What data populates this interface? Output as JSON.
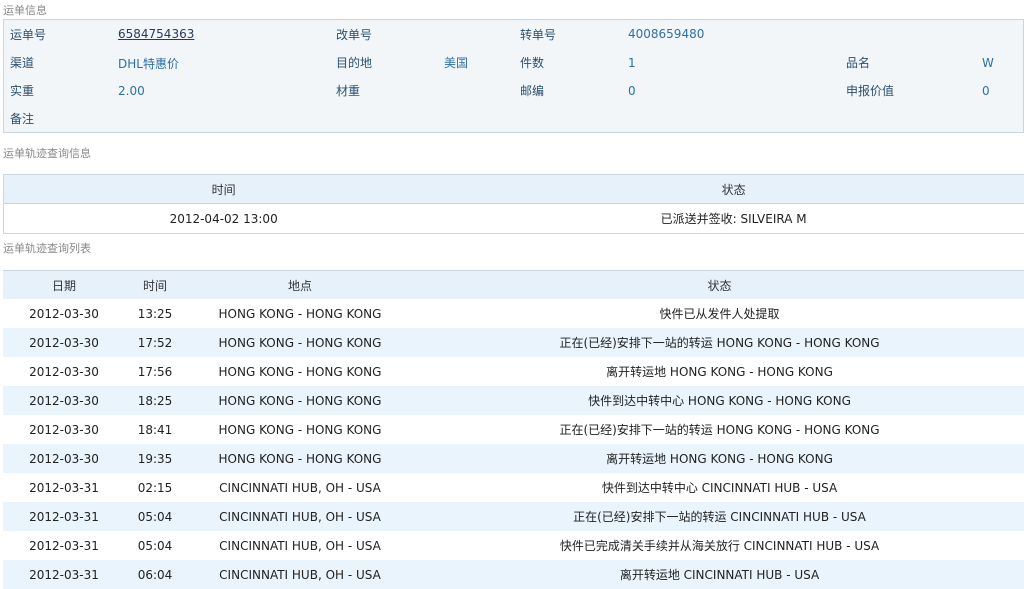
{
  "sections": {
    "info_title": "运单信息",
    "trace_title": "运单轨迹查询信息",
    "list_title": "运单轨迹查询列表"
  },
  "info": {
    "waybill_label": "运单号",
    "waybill_value": "6584754363",
    "change_label": "改单号",
    "change_value": "",
    "transfer_label": "转单号",
    "transfer_value": "4008659480",
    "channel_label": "渠道",
    "channel_value": "DHL特惠价",
    "dest_label": "目的地",
    "dest_value": "美国",
    "pieces_label": "件数",
    "pieces_value": "1",
    "product_label": "品名",
    "product_value": "W",
    "weight_label": "实重",
    "weight_value": "2.00",
    "volume_label": "材重",
    "volume_value": "",
    "zip_label": "邮编",
    "zip_value": "0",
    "declared_label": "申报价值",
    "declared_value": "0",
    "remark_label": "备注",
    "remark_value": ""
  },
  "trace_status": {
    "headers": [
      "时间",
      "状态"
    ],
    "row": [
      "2012-04-02 13:00",
      "已派送并签收: SILVEIRA M"
    ]
  },
  "trace_list": {
    "headers": [
      "日期",
      "时间",
      "地点",
      "状态"
    ],
    "rows": [
      [
        "2012-03-30",
        "13:25",
        "HONG KONG - HONG KONG",
        "快件已从发件人处提取"
      ],
      [
        "2012-03-30",
        "17:52",
        "HONG KONG - HONG KONG",
        "正在(已经)安排下一站的转运  HONG KONG - HONG KONG"
      ],
      [
        "2012-03-30",
        "17:56",
        "HONG KONG - HONG KONG",
        "离开转运地  HONG KONG - HONG KONG"
      ],
      [
        "2012-03-30",
        "18:25",
        "HONG KONG - HONG KONG",
        "快件到达中转中心  HONG KONG - HONG KONG"
      ],
      [
        "2012-03-30",
        "18:41",
        "HONG KONG - HONG KONG",
        "正在(已经)安排下一站的转运  HONG KONG - HONG KONG"
      ],
      [
        "2012-03-30",
        "19:35",
        "HONG KONG - HONG KONG",
        "离开转运地  HONG KONG - HONG KONG"
      ],
      [
        "2012-03-31",
        "02:15",
        "CINCINNATI HUB, OH - USA",
        "快件到达中转中心  CINCINNATI HUB - USA"
      ],
      [
        "2012-03-31",
        "05:04",
        "CINCINNATI HUB, OH - USA",
        "正在(已经)安排下一站的转运  CINCINNATI HUB - USA"
      ],
      [
        "2012-03-31",
        "05:04",
        "CINCINNATI HUB, OH - USA",
        "快件已完成清关手续并从海关放行  CINCINNATI HUB - USA"
      ],
      [
        "2012-03-31",
        "06:04",
        "CINCINNATI HUB, OH - USA",
        "离开转运地  CINCINNATI HUB - USA"
      ]
    ]
  }
}
